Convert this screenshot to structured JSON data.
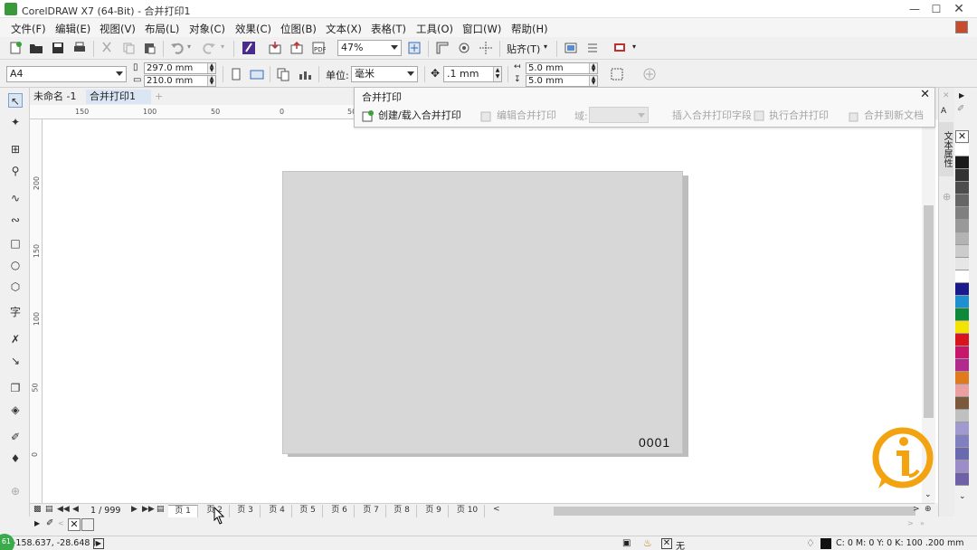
{
  "window": {
    "title": "CorelDRAW X7 (64-Bit) - 合并打印1"
  },
  "menu": [
    "文件(F)",
    "编辑(E)",
    "视图(V)",
    "布局(L)",
    "对象(C)",
    "效果(C)",
    "位图(B)",
    "文本(X)",
    "表格(T)",
    "工具(O)",
    "窗口(W)",
    "帮助(H)"
  ],
  "toolbar": {
    "zoom": "47%",
    "snap_label": "贴齐(T)"
  },
  "propbar": {
    "page_size": "A4",
    "width": "297.0 mm",
    "height": "210.0 mm",
    "unit_label": "单位:",
    "unit": "毫米",
    "nudge": ".1 mm",
    "dup_x": "5.0 mm",
    "dup_y": "5.0 mm"
  },
  "doc_tabs": [
    "未命名 -1",
    "合并打印1"
  ],
  "rulers": {
    "h": [
      "150",
      "100",
      "50",
      "0",
      "50"
    ],
    "v": [
      "200",
      "150",
      "100",
      "50",
      "0"
    ]
  },
  "merge_panel": {
    "title": "合并打印",
    "create_load": "创建/载入合并打印",
    "edit": "编辑合并打印",
    "field_label": "域:",
    "insert_field": "插入合并打印字段",
    "execute": "执行合并打印",
    "merge_new_doc": "合并到新文档"
  },
  "page_content": {
    "number": "0001"
  },
  "pagenav": {
    "counter": "1 / 999",
    "pages": [
      "页 1",
      "页 2",
      "页 3",
      "页 4",
      "页 5",
      "页 6",
      "页 7",
      "页 8",
      "页 9",
      "页 10"
    ],
    "active_index": 0
  },
  "side_panel": {
    "label": "文本属性"
  },
  "status": {
    "coords": "-158.637, -28.648 )",
    "fill_none": "无",
    "outline": "C: 0 M: 0 Y: 0 K: 100  .200 mm"
  },
  "badge": "61",
  "palette": [
    "#ffffff",
    "#1a1a1a",
    "#333333",
    "#4d4d4d",
    "#666666",
    "#808080",
    "#999999",
    "#b3b3b3",
    "#cccccc",
    "#e6e6e6",
    "#ffffff",
    "#1a1a8c",
    "#1e90d0",
    "#0b8a3a",
    "#f2e400",
    "#d8141c",
    "#c8166a",
    "#b32a8e",
    "#e07a1a",
    "#eaa0a0",
    "#7a5a3a",
    "#c0c0c0",
    "#a09ad0",
    "#8080c0",
    "#6a6ab0",
    "#9c8cc8",
    "#7060a8"
  ]
}
